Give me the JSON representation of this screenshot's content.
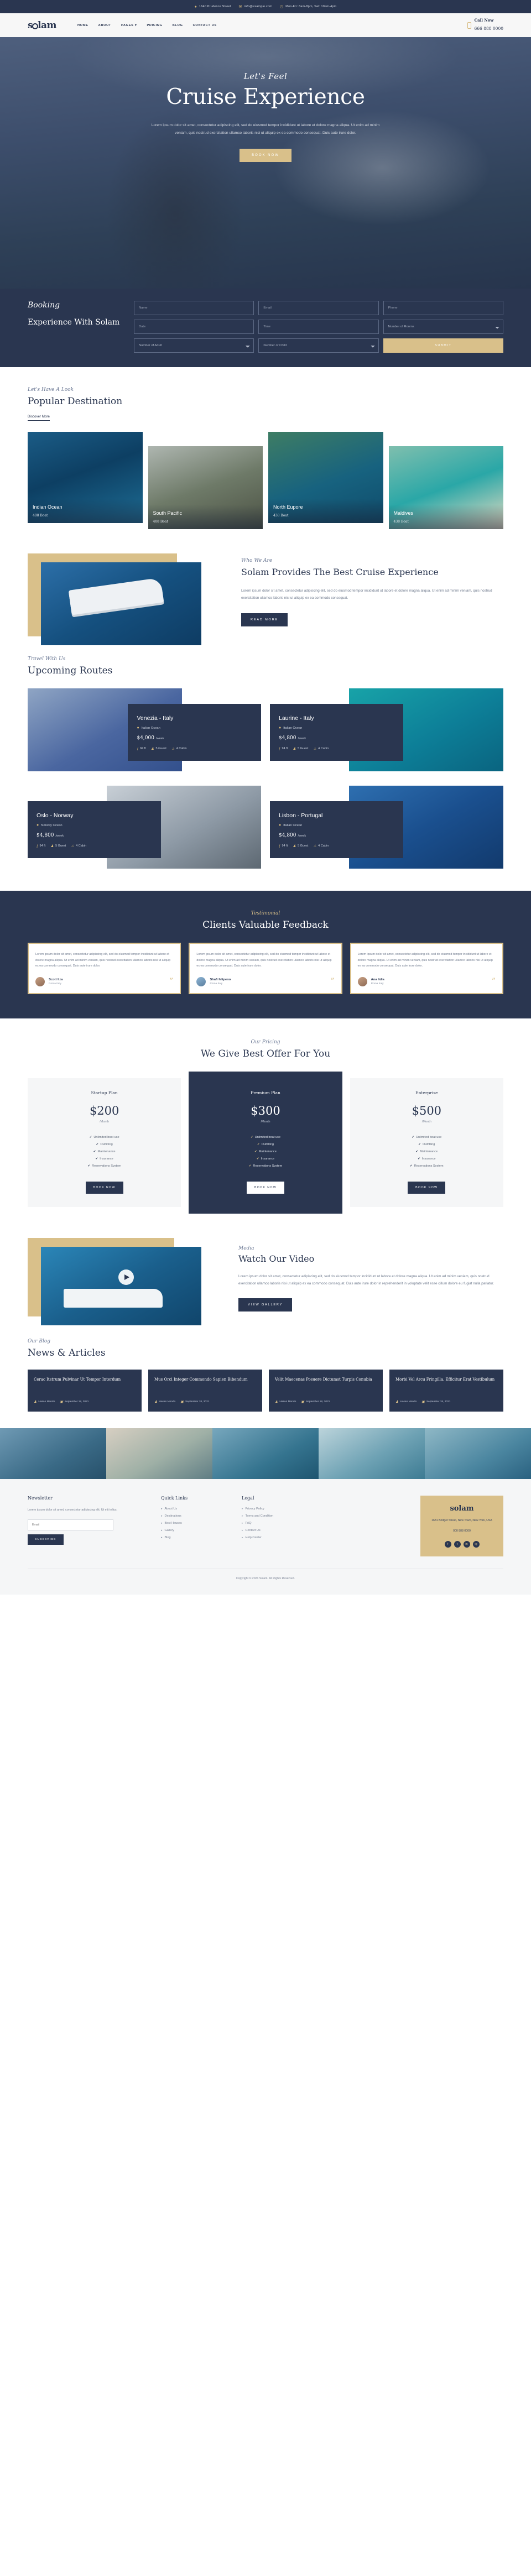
{
  "brand": {
    "name": "solam",
    "accent": "#d9c08a",
    "dark": "#2a3650"
  },
  "topbar": {
    "address": "1640 Prudence Street",
    "email": "info@example.com",
    "hours": "Mon-Fri: 8am-8pm, Sat: 10am-4pm"
  },
  "nav": {
    "items": [
      {
        "label": "HOME"
      },
      {
        "label": "ABOUT"
      },
      {
        "label": "PAGES ▾"
      },
      {
        "label": "PRICING"
      },
      {
        "label": "BLOG"
      },
      {
        "label": "CONTACT US"
      }
    ],
    "call_label": "Call Now",
    "call_number": "666 888 0000"
  },
  "hero": {
    "eyebrow": "Let's Feel",
    "title": "Cruise Experience",
    "body": "Lorem ipsum dolor sit amet, consectetur adipiscing elit, sed do eiusmod tempor incididunt ut labore et dolore magna aliqua. Ut enim ad minim veniam, quis nostrud exercitation ullamco laboris nisi ut aliquip ex ea commodo consequat. Duis aute irure dolor.",
    "cta": "BOOK NOW"
  },
  "booking": {
    "eyebrow": "Booking",
    "title": "Experience With Solam",
    "name_ph": "Name",
    "email_ph": "Email",
    "phone_ph": "Phone",
    "date_ph": "Date",
    "time_ph": "Time",
    "rooms": "Number of Rooms",
    "adults": "Number of Adult",
    "children": "Number of Child",
    "submit": "SUBMIT"
  },
  "destinations": {
    "eyebrow": "Let's Have A Look",
    "title": "Popular Destination",
    "link": "Discover More",
    "items": [
      {
        "name": "Indian Ocean",
        "boats": "408 Boat"
      },
      {
        "name": "South Pacific",
        "boats": "408 Boat"
      },
      {
        "name": "North Eupore",
        "boats": "438 Boat"
      },
      {
        "name": "Maldives",
        "boats": "438 Boat"
      }
    ]
  },
  "about": {
    "eyebrow": "Who We Are",
    "title": "Solam Provides The Best Cruise Experience",
    "body": "Lorem ipsum dolor sit amet, consectetur adipiscing elit, sed do eiusmod tempor incididunt ut labore et dolore magna aliqua. Ut enim ad minim veniam, quis nostrud exercitation ullamco laboris nisi ut aliquip ex ea commodo consequat.",
    "cta": "READ MORE"
  },
  "routes": {
    "eyebrow": "Travel With Us",
    "title": "Upcoming Routes",
    "items": [
      {
        "name": "Venezia - Italy",
        "ocean": "Italian Ocean",
        "price": "$4,000",
        "per": "/week",
        "length": "94 ft",
        "guests": "5 Guest",
        "cabins": "4 Cabin"
      },
      {
        "name": "Laurine - Italy",
        "ocean": "Italian Ocean",
        "price": "$4,800",
        "per": "/week",
        "length": "94 ft",
        "guests": "5 Guest",
        "cabins": "4 Cabin"
      },
      {
        "name": "Oslo - Norway",
        "ocean": "Norway Ocean",
        "price": "$4,800",
        "per": "/week",
        "length": "94 ft",
        "guests": "5 Guest",
        "cabins": "4 Cabin"
      },
      {
        "name": "Lisbon - Portugal",
        "ocean": "Italian Ocean",
        "price": "$4,800",
        "per": "/week",
        "length": "94 ft",
        "guests": "5 Guest",
        "cabins": "4 Cabin"
      }
    ]
  },
  "testimonial": {
    "eyebrow": "Testimonial",
    "title": "Clients Valuable Feedback",
    "quote": "Lorem ipsum dolor sit amet, consectetur adipiscing elit, sed do eiusmod tempor incididunt ut labore et dolore magna aliqua. Ut enim ad minim veniam, quis nostrud exercitation ullamco laboris nisi ut aliquip ex ea commodo consequat. Duis aute irure dolor.",
    "items": [
      {
        "name": "Scott liza",
        "role": "Roma Italy"
      },
      {
        "name": "Shafi felipeno",
        "role": "Roma Italy"
      },
      {
        "name": "Ana lidia",
        "role": "Roma Italy"
      }
    ]
  },
  "pricing": {
    "eyebrow": "Our Pricing",
    "title": "We Give Best Offer For You",
    "features": [
      "Unlimited boat use",
      "Outfitting",
      "Maintenance",
      "Insurance",
      "Reservations System"
    ],
    "cta": "BOOK NOW",
    "per": "/Month",
    "plans": [
      {
        "name": "Startup Plan",
        "price": "$200"
      },
      {
        "name": "Premium Plan",
        "price": "$300"
      },
      {
        "name": "Enterprise",
        "price": "$500"
      }
    ]
  },
  "video": {
    "eyebrow": "Media",
    "title": "Watch Our Video",
    "body": "Lorem ipsum dolor sit amet, consectetur adipiscing elit, sed do eiusmod tempor incididunt ut labore et dolore magna aliqua. Ut enim ad minim veniam, quis nostrud exercitation ullamco laboris nisi ut aliquip ex ea commodo consequat. Duis aute irure dolor in reprehenderit in voluptate velit esse cillum dolore eu fugiat nulla pariatur.",
    "cta": "VIEW GALLERY"
  },
  "blog": {
    "eyebrow": "Our Blog",
    "title": "News & Articles",
    "items": [
      {
        "title": "Cerac Itstrum Pulvinar Ut Tempor Interdum",
        "author": "Hasan Mondo",
        "date": "September 18, 2021"
      },
      {
        "title": "Mus Orci Integer Commondo Sapien Bibendum",
        "author": "Hasan Mondo",
        "date": "September 18, 2021"
      },
      {
        "title": "Velit Maecenas Posuere Dictumst Turpis Conubia",
        "author": "Hasan Mondo",
        "date": "September 18, 2021"
      },
      {
        "title": "Morbi Vel Arcu Fringilla, Efficitur Erat Vestibulum",
        "author": "Hasan Mondo",
        "date": "September 18, 2021"
      }
    ]
  },
  "footer": {
    "newsletter_title": "Newsletter",
    "newsletter_body": "Lorem ipsum dolor sit amet, consectetur adipiscing elit. Ut elit tellus.",
    "email_ph": "Email",
    "subscribe": "SUBSCRIBE",
    "quick_title": "Quick Links",
    "quick_links": [
      "About Us",
      "Destinations",
      "Best Houses",
      "Gallery",
      "Blog"
    ],
    "legal_title": "Legal",
    "legal_links": [
      "Privacy Policy",
      "Terms and Condition",
      "FAQ",
      "Contact Us",
      "Help Center"
    ],
    "card_logo": "solam",
    "card_address": "1681 Bridget Street, New Town, New York, USA",
    "card_phone": "000 888 0000",
    "socials": [
      "f",
      "t",
      "in",
      "ig"
    ],
    "copyright": "Copyright © 2021 Solam. All Rights Reserved."
  }
}
